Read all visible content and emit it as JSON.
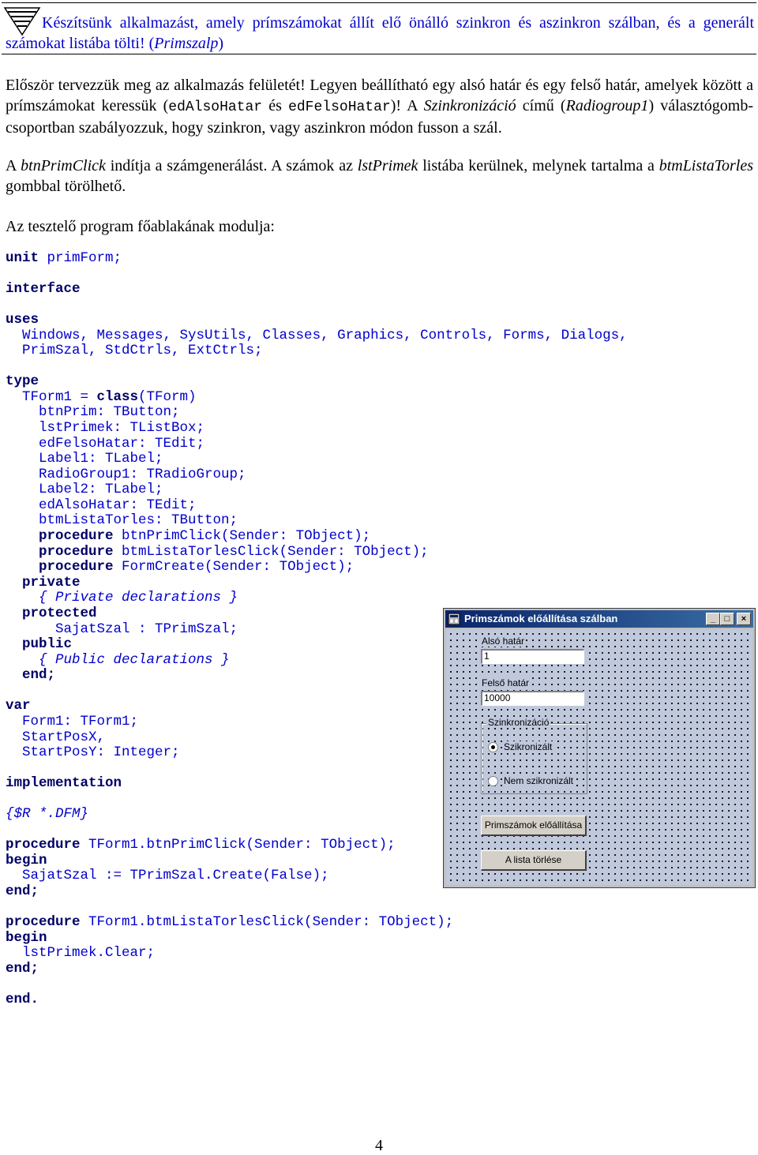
{
  "task": {
    "text_before": "Készítsünk alkalmazást, amely prímszámokat állít elő önálló szinkron és aszinkron szálban, és a generált számokat listába tölti! (",
    "project_name": "Primszalp",
    "text_after": ")"
  },
  "paragraph1": {
    "t1": "Először tervezzük meg az alkalmazás felületét! Legyen beállítható egy alsó határ és egy felső határ, amelyek között a prímszámokat keressük (",
    "ref1": "edAlsoHatar",
    "t2": " és ",
    "ref2": "edFelsoHatar",
    "t3": ")! A ",
    "ref3": "Szinkronizáció",
    "t4": " című (",
    "ref4": "Radiogroup1",
    "t5": ") választógomb-csoportban szabályozzuk, hogy szinkron, vagy aszinkron módon fusson a szál."
  },
  "paragraph2": {
    "t1": "A ",
    "ref1": "btnPrimClick",
    "t2": " indítja a számgenerálást. A számok az ",
    "ref2": "lstPrimek",
    "t3": " listába kerülnek, melynek tartalma a ",
    "ref3": "btmListaTorles",
    "t4": " gombbal törölhető."
  },
  "paragraph3": "Az tesztelő program főablakának modulja:",
  "code": {
    "unit_kw": "unit",
    "unit_rest": " primForm;",
    "interface_kw": "interface",
    "uses_kw": "uses",
    "uses_line1": "  Windows, Messages, SysUtils, Classes, Graphics, Controls, Forms, Dialogs,",
    "uses_line2": "  PrimSzal, StdCtrls, ExtCtrls;",
    "type_kw": "type",
    "tform_a": "  TForm1 = ",
    "class_kw": "class",
    "tform_b": "(TForm)",
    "field1": "    btnPrim: TButton;",
    "field2": "    lstPrimek: TListBox;",
    "field3": "    edFelsoHatar: TEdit;",
    "field4": "    Label1: TLabel;",
    "field5": "    RadioGroup1: TRadioGroup;",
    "field6": "    Label2: TLabel;",
    "field7": "    edAlsoHatar: TEdit;",
    "field8": "    btmListaTorles: TButton;",
    "proc_kw": "procedure",
    "decl1": " btnPrimClick(Sender: TObject);",
    "decl2": " btmListaTorlesClick(Sender: TObject);",
    "decl3": " FormCreate(Sender: TObject);",
    "private_kw": "private",
    "private_comment": "{ Private declarations }",
    "protected_kw": "protected",
    "protected_field": "      SajatSzal : TPrimSzal;",
    "public_kw": "public",
    "public_comment": "{ Public declarations }",
    "end_kw": "end;",
    "var_kw": "var",
    "var1": "  Form1: TForm1;",
    "var2": "  StartPosX,",
    "var3": "  StartPosY: Integer;",
    "implementation_kw": "implementation",
    "directive": "{$R *.DFM}",
    "impl1": " TForm1.btnPrimClick(Sender: TObject);",
    "begin_kw": "begin",
    "impl1_body": "  SajatSzal := TPrimSzal.Create(False);",
    "impl2": " TForm1.btmListaTorlesClick(Sender: TObject);",
    "impl2_body": "  lstPrimek.Clear;",
    "final_end": "end."
  },
  "form_window": {
    "title": "Primszámok előállítása szálban",
    "label_also": "Alsó határ",
    "edit_also": "1",
    "label_felso": "Felső határ",
    "edit_felso": "10000",
    "group_caption": "Szinkronizáció",
    "radio1": "Szikronizált",
    "radio2": "Nem szikronizált",
    "btn_generate": "Primszámok előállítása",
    "btn_clear": "A lista törlése",
    "btn_min": "_",
    "btn_max": "□",
    "btn_close": "×"
  },
  "page_number": "4"
}
